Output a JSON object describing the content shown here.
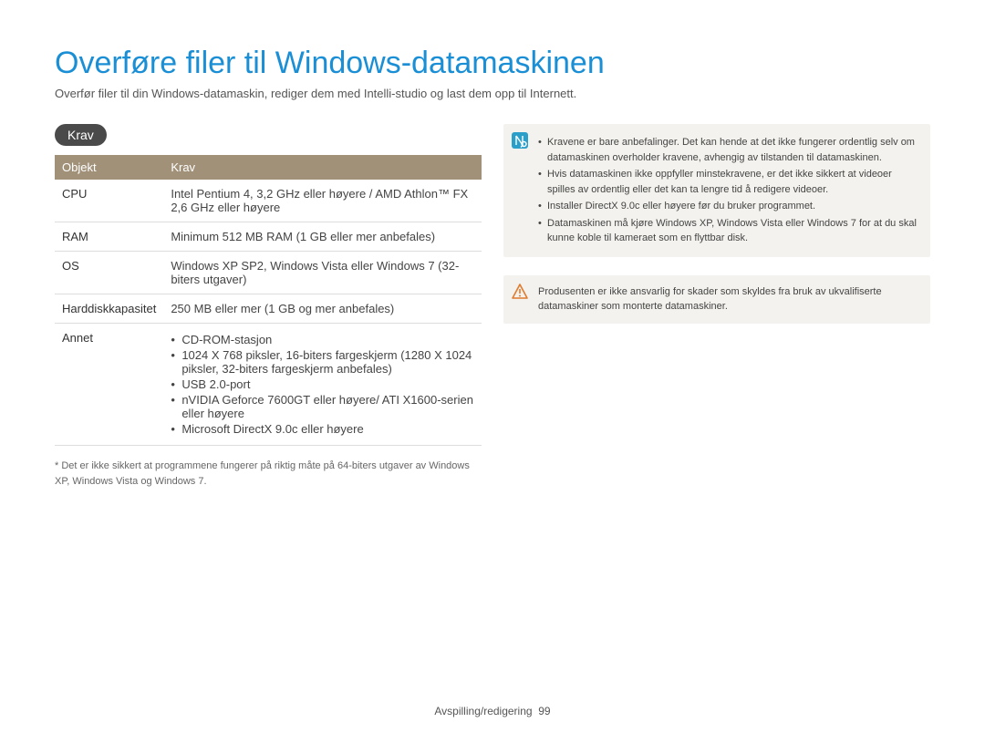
{
  "title": "Overføre filer til Windows-datamaskinen",
  "intro": "Overfør filer til din Windows-datamaskin, rediger dem med Intelli-studio og last dem opp til Internett.",
  "section_label": "Krav",
  "table": {
    "headers": [
      "Objekt",
      "Krav"
    ],
    "rows": [
      {
        "object": "CPU",
        "req": "Intel Pentium 4, 3,2 GHz eller høyere / AMD Athlon™ FX 2,6 GHz eller høyere"
      },
      {
        "object": "RAM",
        "req": "Minimum 512 MB RAM (1 GB eller mer anbefales)"
      },
      {
        "object": "OS",
        "req": "Windows XP SP2, Windows Vista eller Windows 7 (32-biters utgaver)"
      },
      {
        "object": "Harddiskkapasitet",
        "req": "250 MB eller mer (1 GB og mer anbefales)"
      },
      {
        "object": "Annet",
        "bullets": [
          "CD-ROM-stasjon",
          "1024 X 768 piksler, 16-biters fargeskjerm (1280 X 1024 piksler, 32-biters fargeskjerm anbefales)",
          "USB 2.0-port",
          "nVIDIA Geforce 7600GT eller høyere/ ATI X1600-serien eller høyere",
          "Microsoft DirectX 9.0c eller høyere"
        ]
      }
    ]
  },
  "footnote": "* Det er ikke sikkert at programmene fungerer på riktig måte på 64-biters utgaver av Windows XP, Windows Vista og Windows 7.",
  "info_bullets": [
    "Kravene er bare anbefalinger. Det kan hende at det ikke fungerer ordentlig selv om datamaskinen overholder kravene, avhengig av tilstanden til datamaskinen.",
    "Hvis datamaskinen ikke oppfyller minstekravene, er det ikke sikkert at videoer spilles av ordentlig eller det kan ta lengre tid å redigere videoer.",
    "Installer DirectX 9.0c eller høyere før du bruker programmet.",
    "Datamaskinen må kjøre Windows XP, Windows Vista eller Windows 7 for at du skal kunne koble til kameraet som en flyttbar disk."
  ],
  "warning_text": "Produsenten er ikke ansvarlig for skader som skyldes fra bruk av ukvalifiserte datamaskiner som monterte datamaskiner.",
  "footer": {
    "section": "Avspilling/redigering",
    "page": "99"
  }
}
